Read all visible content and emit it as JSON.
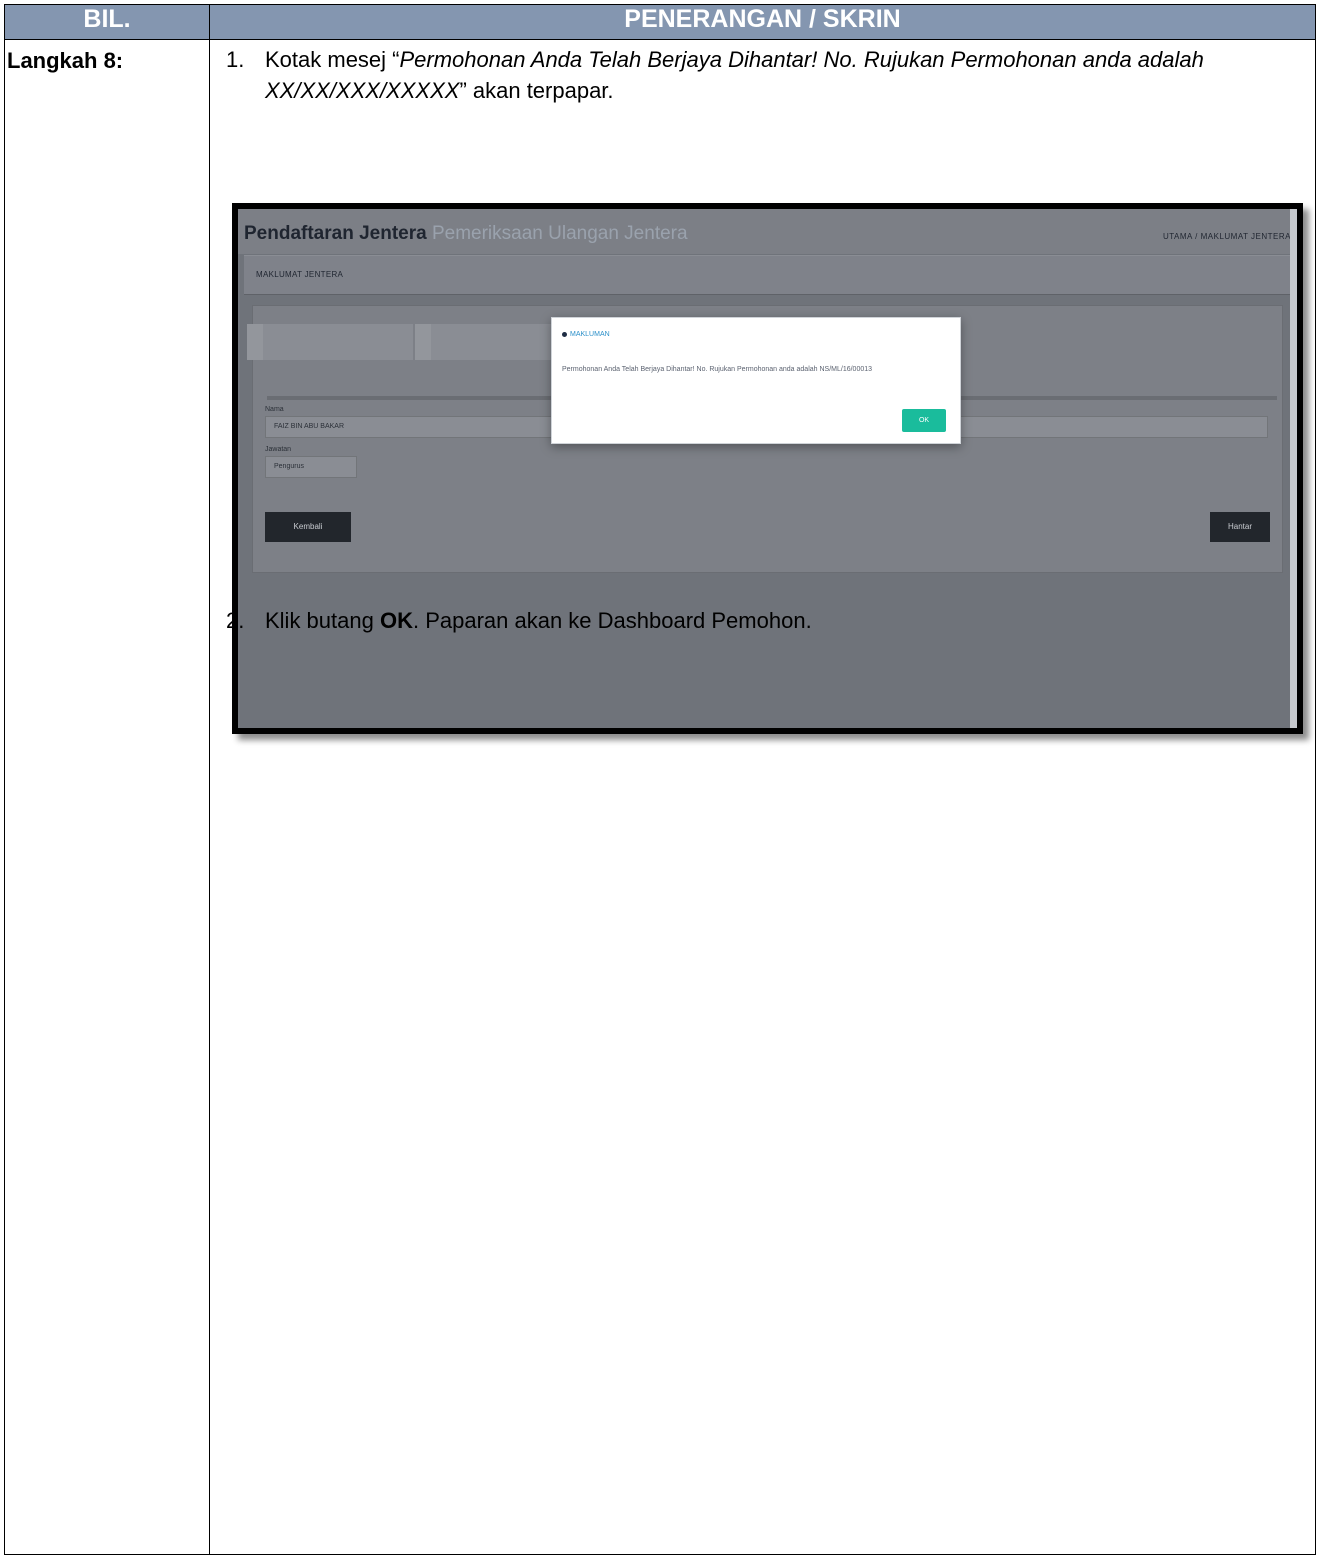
{
  "table": {
    "header_bil": "BIL.",
    "header_content": "PENERANGAN / SKRIN",
    "step_label": "Langkah 8:"
  },
  "steps": [
    {
      "number": "1.",
      "text_pre": "Kotak mesej “",
      "text_italic": "Permohonan Anda Telah Berjaya Dihantar! No. Rujukan Permohonan anda adalah XX/XX/XXX/XXXXX",
      "text_post": "” akan terpapar."
    },
    {
      "number": "2.",
      "text_pre": "Klik butang ",
      "text_bold": "OK",
      "text_post": ". Paparan akan ke Dashboard Pemohon."
    }
  ],
  "screenshot": {
    "app_title_bold": "Pendaftaran Jentera",
    "app_title_light": "Pemeriksaan Ulangan Jentera",
    "breadcrumb": "UTAMA  /  MAKLUMAT JENTERA",
    "section_title": "MAKLUMAT JENTERA",
    "label_nama": "Nama",
    "value_nama": "FAIZ BIN ABU BAKAR",
    "label_jawatan": "Jawatan",
    "value_jawatan": "Pengurus",
    "back_button": "Kembali",
    "submit_button": "Hantar",
    "modal": {
      "title": "MAKLUMAN",
      "message": "Permohonan Anda Telah Berjaya Dihantar! No. Rujukan Permohonan anda adalah NS/ML/16/00013",
      "ok_button": "OK"
    }
  }
}
